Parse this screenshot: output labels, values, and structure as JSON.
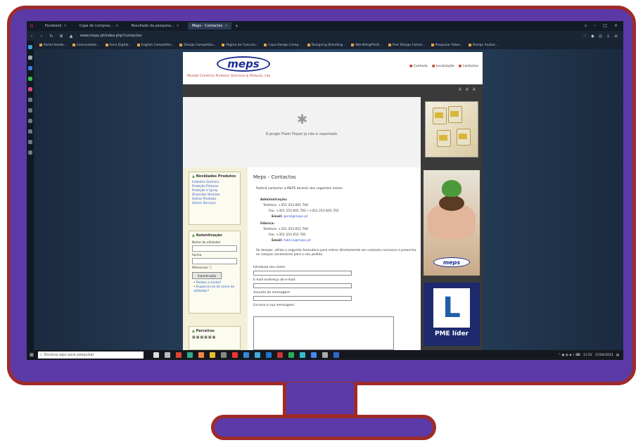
{
  "browser": {
    "tabs": [
      {
        "label": "Facebook",
        "active": false
      },
      {
        "label": "Copa de compras...",
        "active": false
      },
      {
        "label": "Resultado da pesquisa...",
        "active": false
      },
      {
        "label": "Meps - Contactos",
        "active": true
      }
    ],
    "new_tab_label": "+",
    "url": "www.meps.pt/index.php?contactos",
    "bookmarks": [
      "Portal Saúde...",
      "Comunidade...",
      "Feira Digital...",
      "English Competitio...",
      "Design Competitio...",
      "Página de Concurs...",
      "Copa Design Comp...",
      "Designing Branding...",
      "Wordfall@PLUS...",
      "Free Design Comm...",
      "Pesquisar Faber...",
      "Design Avaliar..."
    ]
  },
  "page": {
    "logo_text": "meps",
    "tagline": "Mondal Comércio Produtos Químicos & Pinturas, Lda",
    "top_links": [
      "Contacto",
      "Localização",
      "Contactos"
    ],
    "plugin_message": "O plugin Flash Player já não é suportado.",
    "left_panel": {
      "products_title": "Novidades Produtos",
      "product_links": [
        "Indústria Química",
        "Proteção Pinturas",
        "Proteção e Spray",
        "Diluentes Vernizes",
        "Outros Produtos",
        "Outros Serviços"
      ],
      "login_title": "Autenticação",
      "username_label": "Nome de utilizador",
      "password_label": "Senha",
      "remember_label": "Memorizar",
      "login_button": "Autenticação",
      "forgot_links": [
        "Perdeu a senha?",
        "Esqueceu-se do nome de utilizador?"
      ],
      "partners_title": "Parceiros"
    },
    "content": {
      "title": "Meps - Contactos",
      "intro": "Poderá contactar a MEPS através dos seguintes meios:",
      "section1_title": "Administração:",
      "s1_phone": "Telefone: +351 253 601 700",
      "s1_fax": "Fax: +351 253 601 701 / +351 253 601 702",
      "s1_email_label": "Email:",
      "s1_email": "geral@meps.pt",
      "section2_title": "Fábrica:",
      "s2_phone": "Telefone: +351 253 651 700",
      "s2_fax": "Fax: +351 253 651 701",
      "s2_email_label": "Email:",
      "s2_email": "fabrica@meps.pt",
      "form_intro": "Se desejar, utilize o seguinte formulário para entrar directamente em contacto connosco e preencha os campos necessários para o seu pedido.",
      "form_fields": [
        "Introduza seu nome:",
        "E-mail endereço de e-mail:",
        "Assunto da mensagem:",
        "Escreva a sua mensagem:"
      ]
    },
    "pme_label": "PME líder"
  },
  "taskbar": {
    "search_placeholder": "Escreva aqui para pesquisar",
    "tray_time": "11:52",
    "tray_date": "17/04/2021"
  },
  "colors": {
    "monitor_frame": "#5b3aa8",
    "monitor_border": "#9e2b2b",
    "logo_blue": "#1b2f8f",
    "tagline_red": "#c0392b"
  }
}
